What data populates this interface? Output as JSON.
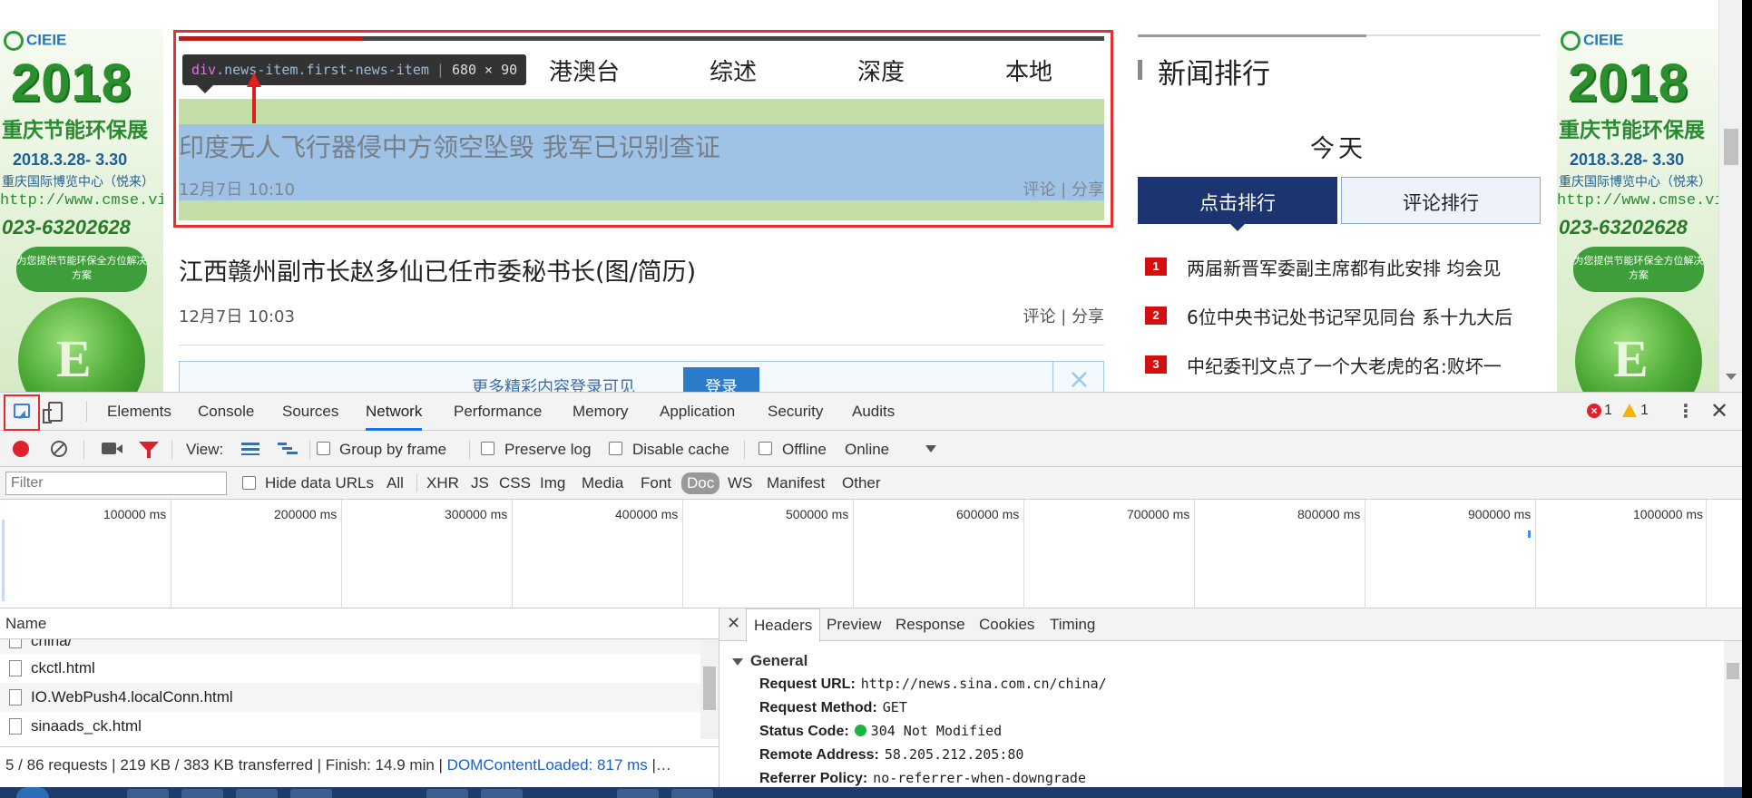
{
  "ad": {
    "logo": "CIEIE",
    "year": "2018",
    "title": "重庆节能环保展",
    "date": "2018.3.28- 3.30",
    "venue": "重庆国际博览中心（悦来）",
    "url": "http://www.cmse.vip",
    "phone": "023-63202628",
    "slogan": "为您提供节能环保全方位解决方案"
  },
  "nav": {
    "items": [
      "港澳台",
      "综述",
      "深度",
      "本地"
    ]
  },
  "tooltip": {
    "tag": "div",
    "classes": ".news-item.first-news-item",
    "size": "680 × 90"
  },
  "news": [
    {
      "title": "印度无人飞行器侵中方领空坠毁 我军已识别查证",
      "time": "12月7日 10:10",
      "actions": "评论 | 分享"
    },
    {
      "title": "江西赣州副市长赵多仙已任市委秘书长(图/简历)",
      "time": "12月7日 10:03",
      "actions": "评论 | 分享"
    }
  ],
  "login_banner": {
    "text": "更多精彩内容登录可见",
    "button": "登录",
    "close": "×"
  },
  "ranking": {
    "title": "新闻排行",
    "period": "今天",
    "tab_click": "点击排行",
    "tab_comment": "评论排行",
    "items": [
      {
        "num": "1",
        "text": "两届新晋军委副主席都有此安排 均会见"
      },
      {
        "num": "2",
        "text": "6位中央书记处书记罕见同台 系十九大后"
      },
      {
        "num": "3",
        "text": "中纪委刊文点了一个大老虎的名:败坏一"
      }
    ]
  },
  "devtools": {
    "tabs": [
      "Elements",
      "Console",
      "Sources",
      "Network",
      "Performance",
      "Memory",
      "Application",
      "Security",
      "Audits"
    ],
    "active_tab": "Network",
    "error_count": "1",
    "warning_count": "1",
    "toolbar": {
      "view_label": "View:",
      "group_by_frame": "Group by frame",
      "preserve_log": "Preserve log",
      "disable_cache": "Disable cache",
      "offline": "Offline",
      "throttle": "Online"
    },
    "filter": {
      "placeholder": "Filter",
      "hide_data_urls": "Hide data URLs",
      "types": [
        "All",
        "XHR",
        "JS",
        "CSS",
        "Img",
        "Media",
        "Font",
        "Doc",
        "WS",
        "Manifest",
        "Other"
      ],
      "active_type": "Doc"
    },
    "timeline_labels": [
      "100000 ms",
      "200000 ms",
      "300000 ms",
      "400000 ms",
      "500000 ms",
      "600000 ms",
      "700000 ms",
      "800000 ms",
      "900000 ms",
      "1000000 ms"
    ],
    "name_header": "Name",
    "requests": [
      "china/",
      "ckctl.html",
      "IO.WebPush4.localConn.html",
      "sinaads_ck.html"
    ],
    "status": {
      "summary": "5 / 86 requests | 219 KB / 383 KB transferred | Finish: 14.9 min | ",
      "dom_content_loaded": "DOMContentLoaded: 817 ms",
      "trail": " |…"
    },
    "details_tabs": [
      "Headers",
      "Preview",
      "Response",
      "Cookies",
      "Timing"
    ],
    "active_details_tab": "Headers",
    "general": {
      "title": "General",
      "request_url_label": "Request URL:",
      "request_url": "http://news.sina.com.cn/china/",
      "request_method_label": "Request Method:",
      "request_method": "GET",
      "status_code_label": "Status Code:",
      "status_code": "304 Not Modified",
      "remote_address_label": "Remote Address:",
      "remote_address": "58.205.212.205:80",
      "referrer_policy_label": "Referrer Policy:",
      "referrer_policy": "no-referrer-when-downgrade"
    }
  },
  "colors": {
    "highlight_border": "#e53030",
    "accent_blue": "#1a73e8",
    "rank_dark_blue": "#1c3470",
    "rank_red": "#d40f0f",
    "record_red": "#e0202b"
  }
}
